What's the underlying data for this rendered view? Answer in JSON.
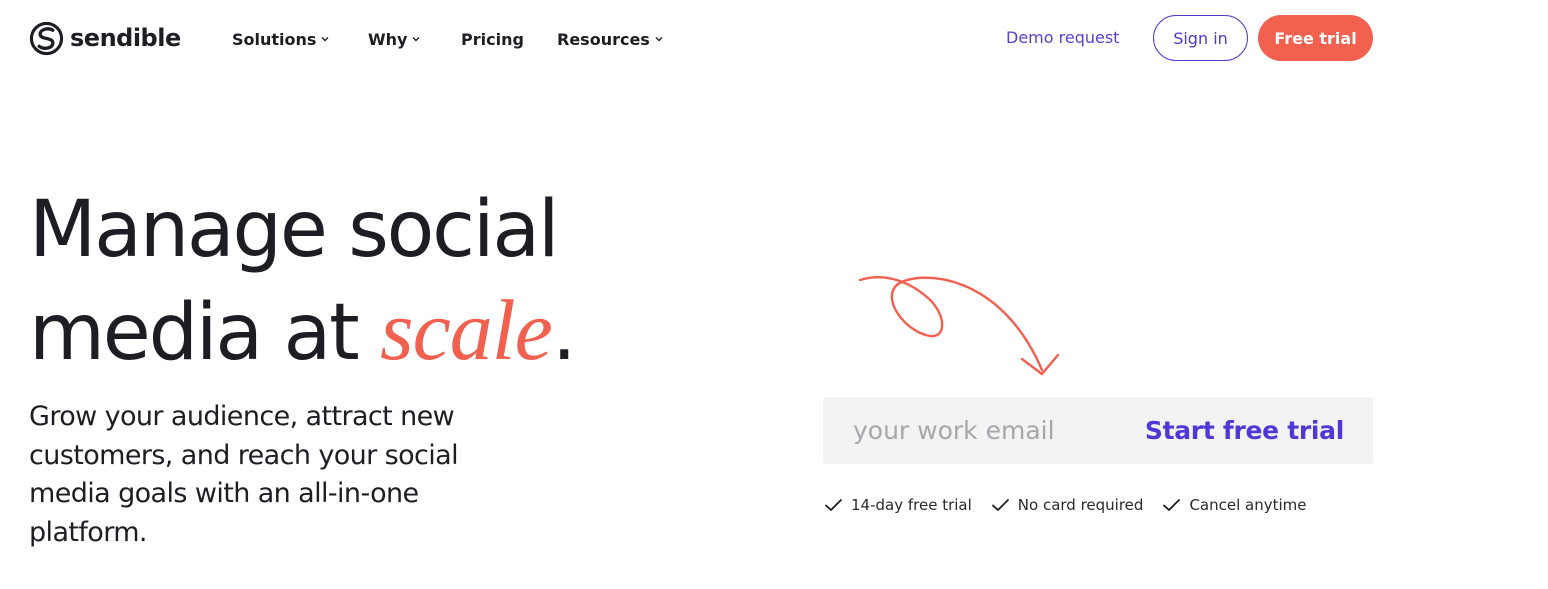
{
  "header": {
    "logo": {
      "icon": "sendible-s-logo-icon",
      "text": "sendible"
    },
    "nav": [
      {
        "label": "Solutions",
        "has_dropdown": true
      },
      {
        "label": "Why",
        "has_dropdown": true
      },
      {
        "label": "Pricing",
        "has_dropdown": false
      },
      {
        "label": "Resources",
        "has_dropdown": true
      }
    ],
    "demo_request": "Demo request",
    "sign_in": "Sign in",
    "free_trial": "Free trial"
  },
  "hero": {
    "title_line1": "Manage social",
    "title_line2_prefix": "media at ",
    "title_accent": "scale",
    "title_suffix": ".",
    "subtitle": "Grow your audience, attract new customers, and reach your social media goals with an all-in-one platform."
  },
  "signup": {
    "email_placeholder": "your work email",
    "email_value": "",
    "cta_label": "Start free trial",
    "arrow_icon": "curly-arrow-down-icon",
    "perks": [
      {
        "icon": "checkmark-icon",
        "label": "14-day free trial"
      },
      {
        "icon": "checkmark-icon",
        "label": "No card required"
      },
      {
        "icon": "checkmark-icon",
        "label": "Cancel anytime"
      }
    ]
  },
  "colors": {
    "text_dark": "#1f1d24",
    "accent_coral": "#f2604f",
    "brand_purple": "#4f39d6",
    "input_bg": "#f3f3f4",
    "placeholder_gray": "#a7a6ab"
  }
}
